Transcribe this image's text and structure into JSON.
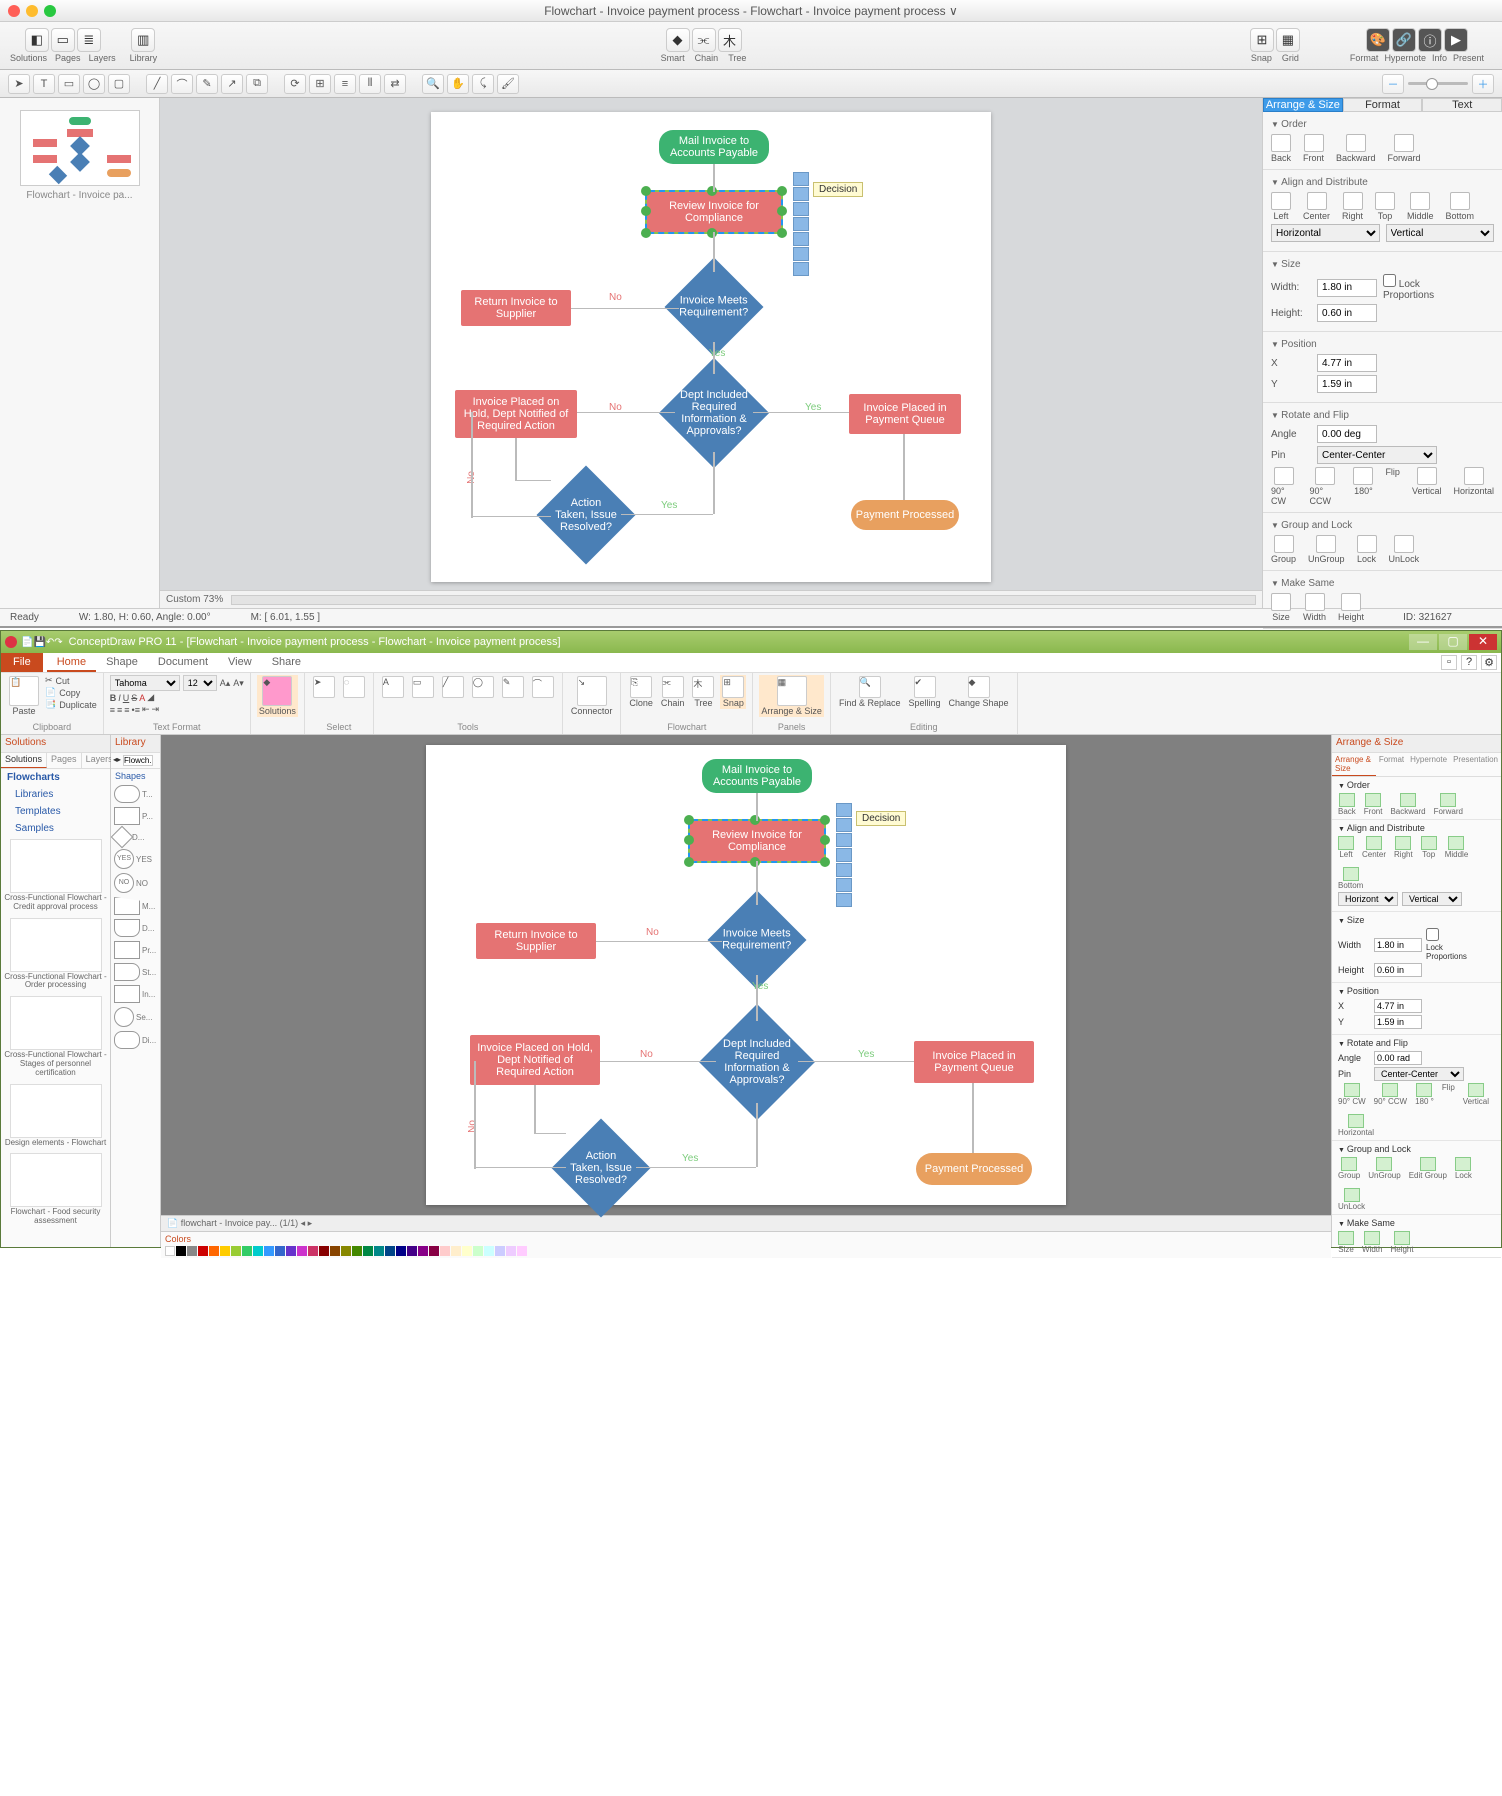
{
  "mac": {
    "title": "Flowchart - Invoice payment process - Flowchart - Invoice payment process ∨",
    "toolbar": {
      "solutions": "Solutions",
      "pages": "Pages",
      "layers": "Layers",
      "library": "Library",
      "smart": "Smart",
      "chain": "Chain",
      "tree": "Tree",
      "snap": "Snap",
      "grid": "Grid",
      "format": "Format",
      "hypernote": "Hypernote",
      "info": "Info",
      "present": "Present"
    },
    "zoom_label": "Custom 73%",
    "status": {
      "ready": "Ready",
      "whangle": "W: 1.80,  H: 0.60,  Angle: 0.00°",
      "mouse": "M: [ 6.01, 1.55 ]",
      "id": "ID: 321627"
    },
    "thumb_label": "Flowchart - Invoice pa...",
    "panel": {
      "tabs": [
        "Arrange & Size",
        "Format",
        "Text"
      ],
      "order": {
        "h": "Order",
        "items": [
          "Back",
          "Front",
          "Backward",
          "Forward"
        ]
      },
      "align": {
        "h": "Align and Distribute",
        "items": [
          "Left",
          "Center",
          "Right",
          "Top",
          "Middle",
          "Bottom"
        ],
        "horiz": "Horizontal",
        "vert": "Vertical"
      },
      "size": {
        "h": "Size",
        "width_l": "Width:",
        "width": "1.80 in",
        "height_l": "Height:",
        "height": "0.60 in",
        "lock": "Lock Proportions"
      },
      "pos": {
        "h": "Position",
        "xl": "X",
        "x": "4.77 in",
        "yl": "Y",
        "y": "1.59 in"
      },
      "rot": {
        "h": "Rotate and Flip",
        "angle_l": "Angle",
        "angle": "0.00 deg",
        "pin_l": "Pin",
        "pin": "Center-Center",
        "items": [
          "90° CW",
          "90° CCW",
          "180°"
        ],
        "flip": "Flip",
        "flips": [
          "Vertical",
          "Horizontal"
        ]
      },
      "grp": {
        "h": "Group and Lock",
        "items": [
          "Group",
          "UnGroup",
          "Lock",
          "UnLock"
        ]
      },
      "same": {
        "h": "Make Same",
        "items": [
          "Size",
          "Width",
          "Height"
        ]
      }
    },
    "tooltip": "Decision"
  },
  "flow": {
    "n1": "Mail Invoice to Accounts Payable",
    "n2": "Review Invoice for Compliance",
    "n3": "Return Invoice to Supplier",
    "n4": "Invoice Meets Requirement?",
    "n5": "Invoice Placed on Hold, Dept Notified of Required Action",
    "n6": "Dept Included Required Information & Approvals?",
    "n7": "Invoice Placed in Payment Queue",
    "n8": "Action Taken, Issue Resolved?",
    "n9": "Payment Processed",
    "no": "No",
    "yes": "Yes"
  },
  "win": {
    "title": "ConceptDraw PRO 11 - [Flowchart - Invoice payment process - Flowchart - Invoice payment process]",
    "ribbon_tabs": [
      "Home",
      "Shape",
      "Document",
      "View",
      "Share"
    ],
    "clipboard": {
      "cut": "Cut",
      "copy": "Copy",
      "dup": "Duplicate",
      "paste": "Paste",
      "h": "Clipboard"
    },
    "textfmt": {
      "font": "Tahoma",
      "size": "12",
      "h": "Text Format"
    },
    "groups": {
      "solutions": "Solutions",
      "select": "Select",
      "tools": "Tools",
      "connector": "Connector",
      "clone": "Clone",
      "chain": "Chain",
      "tree": "Tree",
      "snap": "Snap",
      "arrange": "Arrange & Size",
      "flowchart": "Flowchart",
      "panels": "Panels",
      "find": "Find & Replace",
      "spelling": "Spelling",
      "change": "Change Shape",
      "editing": "Editing"
    },
    "left": {
      "solutions": "Solutions",
      "tabs": [
        "Solutions",
        "Pages",
        "Layers"
      ],
      "tree": [
        "Flowcharts",
        "Libraries",
        "Templates",
        "Samples"
      ],
      "thumbs": [
        "Cross-Functional Flowchart - Credit approval process",
        "Cross-Functional Flowchart - Order processing",
        "Cross-Functional Flowchart - Stages of personnel certification",
        "Design elements - Flowchart",
        "Flowchart - Food security assessment"
      ]
    },
    "lib": {
      "h": "Library",
      "search": "Flowch...",
      "shapes": "Shapes",
      "items": [
        "T...",
        "P...",
        "D...",
        "YES",
        "NO",
        "M...",
        "D...",
        "Pr...",
        "St...",
        "In...",
        "Se...",
        "Di..."
      ]
    },
    "btm_tab": "flowchart - Invoice pay...  (1/1)",
    "colors_h": "Colors",
    "right": {
      "h": "Arrange & Size",
      "tabs": [
        "Arrange & Size",
        "Format",
        "Hypernote",
        "Presentation"
      ],
      "order": {
        "h": "Order",
        "items": [
          "Back",
          "Front",
          "Backward",
          "Forward"
        ]
      },
      "align": {
        "h": "Align and Distribute",
        "items": [
          "Left",
          "Center",
          "Right",
          "Top",
          "Middle",
          "Bottom"
        ],
        "horiz": "Horizontal",
        "vert": "Vertical"
      },
      "size": {
        "h": "Size",
        "wl": "Width",
        "w": "1.80 in",
        "hl": "Height",
        "hv": "0.60 in",
        "lock": "Lock Proportions"
      },
      "pos": {
        "h": "Position",
        "xl": "X",
        "x": "4.77 in",
        "yl": "Y",
        "y": "1.59 in"
      },
      "rot": {
        "h": "Rotate and Flip",
        "al": "Angle",
        "a": "0.00 rad",
        "pl": "Pin",
        "p": "Center-Center",
        "items": [
          "90° CW",
          "90° CCW",
          "180 °"
        ],
        "flip": "Flip",
        "flips": [
          "Vertical",
          "Horizontal"
        ]
      },
      "grp": {
        "h": "Group and Lock",
        "items": [
          "Group",
          "UnGroup",
          "Edit Group",
          "Lock",
          "UnLock"
        ]
      },
      "same": {
        "h": "Make Same",
        "items": [
          "Size",
          "Width",
          "Height"
        ]
      }
    },
    "tooltip": "Decision"
  }
}
